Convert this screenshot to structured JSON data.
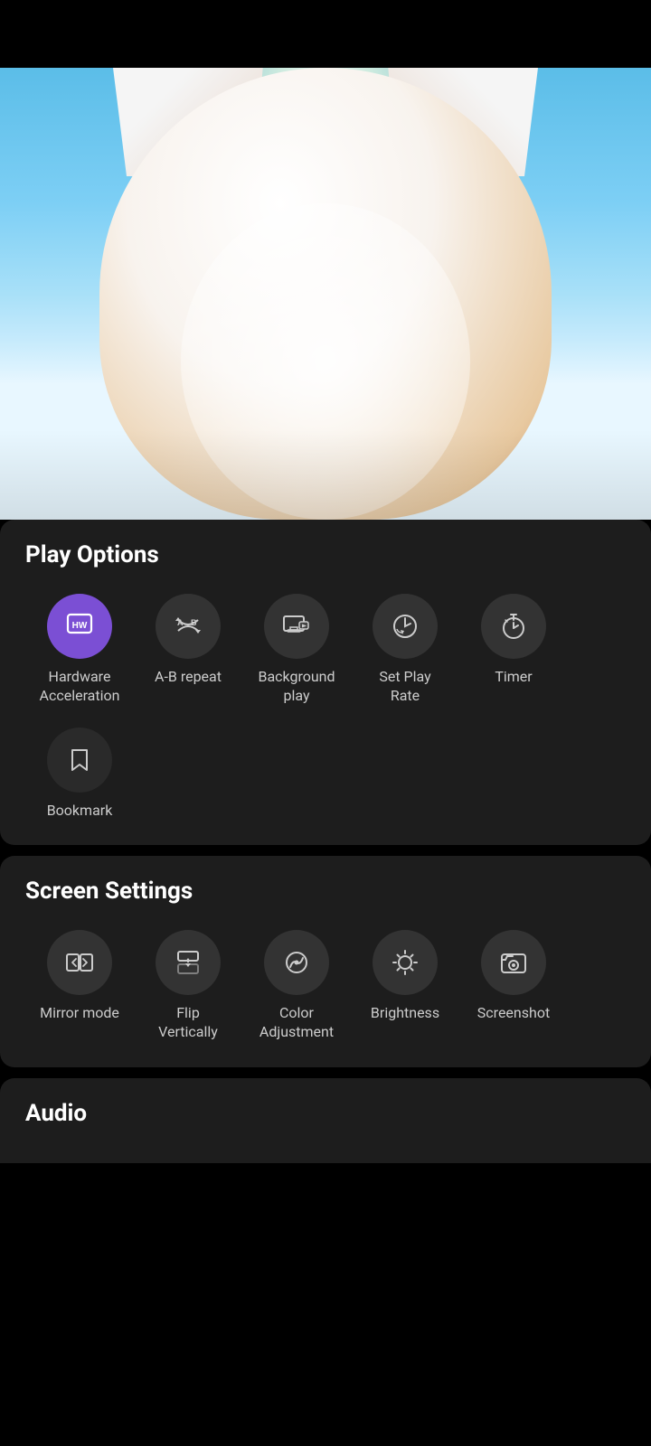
{
  "top_bar": {
    "bg": "#000000"
  },
  "video_area": {
    "bg_gradient": "sky blue"
  },
  "play_options": {
    "title": "Play Options",
    "items": [
      {
        "id": "hardware-acceleration",
        "label": "Hardware\nAcceleration",
        "label_line1": "Hardware",
        "label_line2": "Acceleration",
        "icon": "HW",
        "active": true
      },
      {
        "id": "ab-repeat",
        "label": "A-B repeat",
        "label_line1": "A-B repeat",
        "label_line2": "",
        "icon": "ab",
        "active": false
      },
      {
        "id": "background-play",
        "label": "Background\nplay",
        "label_line1": "Background",
        "label_line2": "play",
        "icon": "bg-play",
        "active": false
      },
      {
        "id": "set-play-rate",
        "label": "Set Play\nRate",
        "label_line1": "Set Play",
        "label_line2": "Rate",
        "icon": "rate",
        "active": false
      },
      {
        "id": "timer",
        "label": "Timer",
        "label_line1": "Timer",
        "label_line2": "",
        "icon": "timer",
        "active": false
      },
      {
        "id": "bookmark",
        "label": "Bookmark",
        "label_line1": "Bookmark",
        "label_line2": "",
        "icon": "bookmark",
        "active": false
      }
    ]
  },
  "screen_settings": {
    "title": "Screen Settings",
    "items": [
      {
        "id": "mirror-mode",
        "label": "Mirror mode",
        "label_line1": "Mirror mode",
        "label_line2": "",
        "icon": "mirror"
      },
      {
        "id": "flip-vertically",
        "label": "Flip\nVertically",
        "label_line1": "Flip",
        "label_line2": "Vertically",
        "icon": "flip"
      },
      {
        "id": "color-adjustment",
        "label": "Color\nAdjustment",
        "label_line1": "Color",
        "label_line2": "Adjustment",
        "icon": "color"
      },
      {
        "id": "brightness",
        "label": "Brightness",
        "label_line1": "Brightness",
        "label_line2": "",
        "icon": "brightness"
      },
      {
        "id": "screenshot",
        "label": "Screenshot",
        "label_line1": "Screenshot",
        "label_line2": "",
        "icon": "screenshot"
      }
    ]
  },
  "audio": {
    "title": "Audio"
  }
}
